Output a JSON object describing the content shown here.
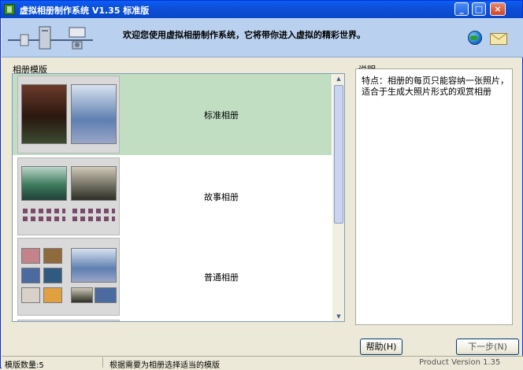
{
  "window": {
    "title": "虚拟相册制作系统 V1.35  标准版",
    "controls": {
      "minimize": "_",
      "maximize": "□",
      "close": "×"
    }
  },
  "banner": {
    "welcome": "欢迎您使用虚拟相册制作系统，它将带你进入虚拟的精彩世界。",
    "icons": [
      "network-icon",
      "globe-icon",
      "mail-icon"
    ]
  },
  "albums": {
    "label": "相册模版",
    "items": [
      {
        "name": "标准相册",
        "selected": true
      },
      {
        "name": "故事相册",
        "selected": false
      },
      {
        "name": "普通相册",
        "selected": false
      }
    ],
    "scroll_position": 0.0
  },
  "description": {
    "label": "说明",
    "lines": [
      "特点：相册的每页只能容纳一张照片，",
      "适合于生成大照片形式的观赏相册"
    ]
  },
  "buttons": {
    "help": "帮助(H)",
    "next": "下一步(N)"
  },
  "status": {
    "template_count": "模版数量:5",
    "hint": "根据需要为相册选择适当的模版",
    "version": "Product Version 1.35"
  },
  "colors": {
    "titlebar": "#0a5ef5",
    "banner": "#b9d1ef",
    "selected_row": "#c1dec3"
  }
}
